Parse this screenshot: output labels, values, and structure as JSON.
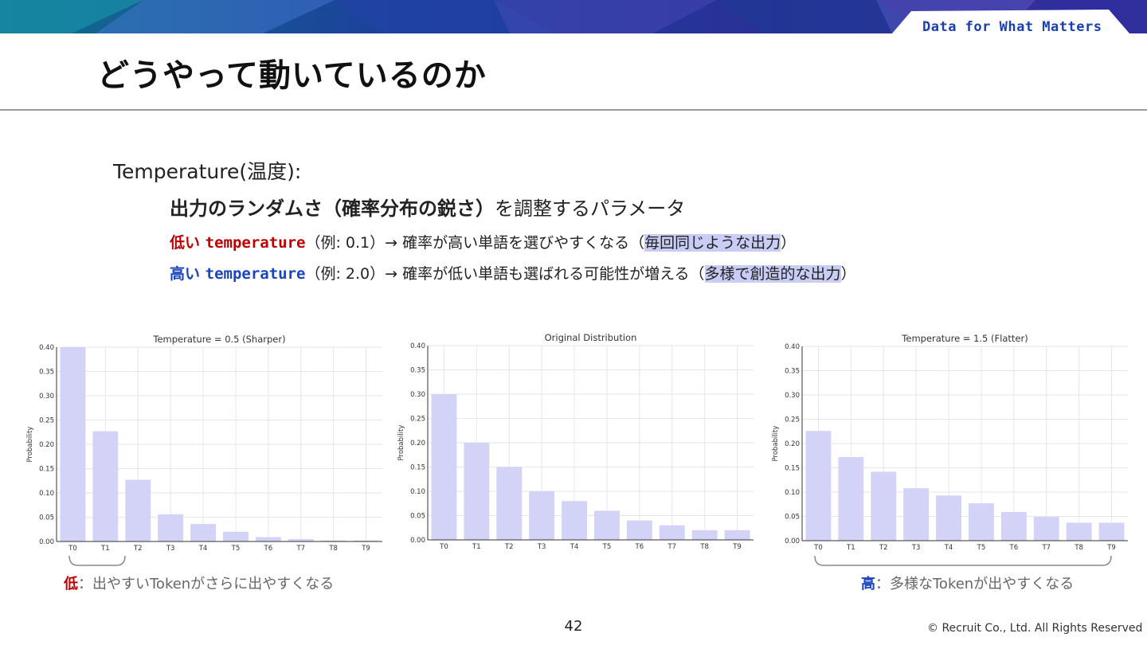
{
  "header": {
    "tagline": "Data for What Matters",
    "title": "どうやって動いているのか"
  },
  "body": {
    "line1": "Temperature(温度):",
    "line2": {
      "bold": "出力のランダムさ（確率分布の鋭さ）",
      "rest": "を調整するパラメータ"
    },
    "low": {
      "kw_jp": "低い",
      "kw_en": "temperature",
      "text": "（例: 0.1）→ 確率が高い単語を選びやすくなる（",
      "highlight": "毎回同じような出力",
      "close": "）"
    },
    "high": {
      "kw_jp": "高い",
      "kw_en": "temperature",
      "text": "（例: 2.0）→ 確率が低い単語も選ばれる可能性が増える（",
      "highlight": "多様で創造的な出力",
      "close": "）"
    }
  },
  "notes": {
    "low": {
      "key": "低",
      "text": "：出やすいTokenがさらに出やすくなる"
    },
    "high": {
      "key": "高",
      "text": "：多様なTokenが出やすくなる"
    }
  },
  "footer": {
    "page": "42",
    "copyright": "© Recruit Co., Ltd. All Rights Reserved"
  },
  "colors": {
    "bar": "#d3d3f7",
    "low": "#c00000",
    "high": "#1a44c0",
    "tagline": "#1b3fb0"
  },
  "chart_data": [
    {
      "type": "bar",
      "title": "Temperature = 0.5 (Sharper)",
      "ylabel": "Probability",
      "categories": [
        "T0",
        "T1",
        "T2",
        "T3",
        "T4",
        "T5",
        "T6",
        "T7",
        "T8",
        "T9"
      ],
      "values": [
        0.4,
        0.227,
        0.127,
        0.056,
        0.036,
        0.02,
        0.009,
        0.005,
        0.002,
        0.002
      ],
      "ylim": [
        0,
        0.4
      ],
      "yticks": [
        "0.00",
        "0.05",
        "0.10",
        "0.15",
        "0.20",
        "0.25",
        "0.30",
        "0.35",
        "0.40"
      ],
      "grid": true
    },
    {
      "type": "bar",
      "title": "Original Distribution",
      "ylabel": "Probability",
      "categories": [
        "T0",
        "T1",
        "T2",
        "T3",
        "T4",
        "T5",
        "T6",
        "T7",
        "T8",
        "T9"
      ],
      "values": [
        0.3,
        0.2,
        0.15,
        0.1,
        0.08,
        0.06,
        0.04,
        0.03,
        0.02,
        0.02
      ],
      "ylim": [
        0,
        0.4
      ],
      "yticks": [
        "0.00",
        "0.05",
        "0.10",
        "0.15",
        "0.20",
        "0.25",
        "0.30",
        "0.35",
        "0.40"
      ],
      "grid": true
    },
    {
      "type": "bar",
      "title": "Temperature = 1.5 (Flatter)",
      "ylabel": "Probability",
      "categories": [
        "T0",
        "T1",
        "T2",
        "T3",
        "T4",
        "T5",
        "T6",
        "T7",
        "T8",
        "T9"
      ],
      "values": [
        0.226,
        0.172,
        0.142,
        0.108,
        0.093,
        0.077,
        0.059,
        0.049,
        0.037,
        0.037
      ],
      "ylim": [
        0,
        0.4
      ],
      "yticks": [
        "0.00",
        "0.05",
        "0.10",
        "0.15",
        "0.20",
        "0.25",
        "0.30",
        "0.35",
        "0.40"
      ],
      "grid": true
    }
  ]
}
